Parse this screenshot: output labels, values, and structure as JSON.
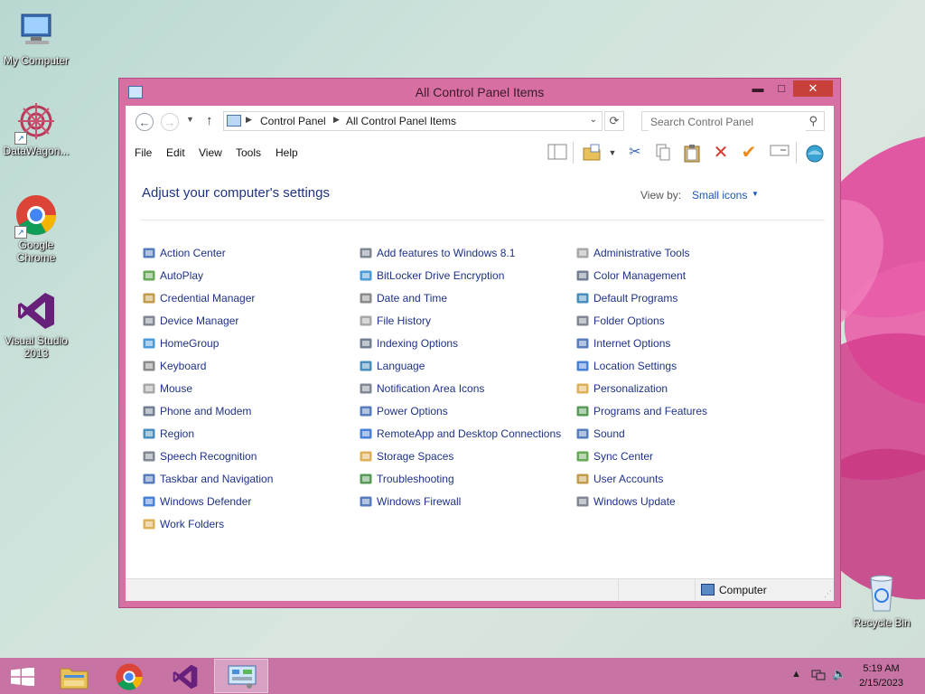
{
  "desktop": {
    "icons": [
      {
        "label": "My Computer",
        "icon": "computer-icon"
      },
      {
        "label": "DataWagon...",
        "icon": "datawagon-icon"
      },
      {
        "label": "Google Chrome",
        "icon": "chrome-icon"
      },
      {
        "label": "Visual Studio 2013",
        "icon": "visual-studio-icon"
      },
      {
        "label": "Recycle Bin",
        "icon": "recycle-bin-icon"
      }
    ]
  },
  "window": {
    "title": "All Control Panel Items",
    "min_glyph": "▬",
    "max_glyph": "□",
    "close_glyph": "✕",
    "back_glyph": "←",
    "forward_glyph": "→",
    "up_glyph": "↑",
    "refresh_glyph": "⟳",
    "breadcrumb": [
      "Control Panel",
      "All Control Panel Items"
    ],
    "search_placeholder": "Search Control Panel",
    "menu": [
      "File",
      "Edit",
      "View",
      "Tools",
      "Help"
    ]
  },
  "content": {
    "heading": "Adjust your computer's settings",
    "view_by_label": "View by:",
    "view_by_value": "Small icons",
    "columns": [
      [
        "Action Center",
        "AutoPlay",
        "Credential Manager",
        "Device Manager",
        "HomeGroup",
        "Keyboard",
        "Mouse",
        "Phone and Modem",
        "Region",
        "Speech Recognition",
        "Taskbar and Navigation",
        "Windows Defender",
        "Work Folders"
      ],
      [
        "Add features to Windows 8.1",
        "BitLocker Drive Encryption",
        "Date and Time",
        "File History",
        "Indexing Options",
        "Language",
        "Notification Area Icons",
        "Power Options",
        "RemoteApp and Desktop Connections",
        "Storage Spaces",
        "Troubleshooting",
        "Windows Firewall"
      ],
      [
        "Administrative Tools",
        "Color Management",
        "Default Programs",
        "Folder Options",
        "Internet Options",
        "Location Settings",
        "Personalization",
        "Programs and Features",
        "Sound",
        "Sync Center",
        "User Accounts",
        "Windows Update"
      ]
    ]
  },
  "statusbar": {
    "location": "Computer"
  },
  "taskbar": {
    "time": "5:19 AM",
    "date": "2/15/2023"
  },
  "colors": {
    "window_frame": "#d86fa3",
    "link_blue": "#1e3287",
    "close_red": "#c7403a",
    "taskbar": "#c774a5"
  }
}
